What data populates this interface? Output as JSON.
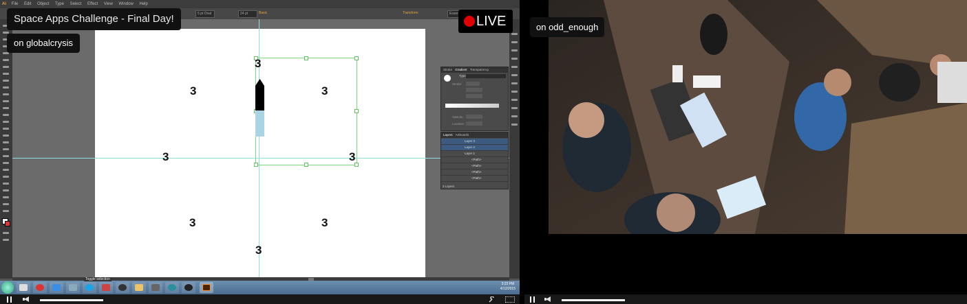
{
  "stream_left": {
    "title": "Space Apps Challenge - Final Day!",
    "user_label": "on globalcrysis",
    "live_label": "LIVE",
    "menu": [
      "File",
      "Edit",
      "Object",
      "Type",
      "Select",
      "Effect",
      "View",
      "Window",
      "Help"
    ],
    "option_bar": {
      "stroke": "5 pt Oval",
      "opacity": "24 pt",
      "style": "Basic",
      "transform": "Transform",
      "workspace": "Essentials"
    },
    "artboard_numbers": [
      "3",
      "3",
      "3",
      "3",
      "3",
      "3",
      "3",
      "3"
    ],
    "gradient_panel": {
      "tabs": [
        "Stroke",
        "Gradient",
        "Transparency"
      ],
      "type_label": "Type:",
      "stroke_label": "Stroke:",
      "opacity_label": "Opacity:",
      "location_label": "Location:"
    },
    "layers_panel": {
      "tabs": [
        "Layers",
        "Artboards"
      ],
      "layers": [
        "Layer 3",
        "Layer 2",
        "Layer 1",
        "<Path>",
        "<Path>",
        "<Path>",
        "<Path>"
      ],
      "footer": "3 Layers"
    },
    "taskbar": {
      "clock_time": "3:23 PM",
      "clock_date": "4/12/2015",
      "tooltip": "Toggle selection"
    }
  },
  "stream_right": {
    "user_label": "on odd_enough"
  }
}
